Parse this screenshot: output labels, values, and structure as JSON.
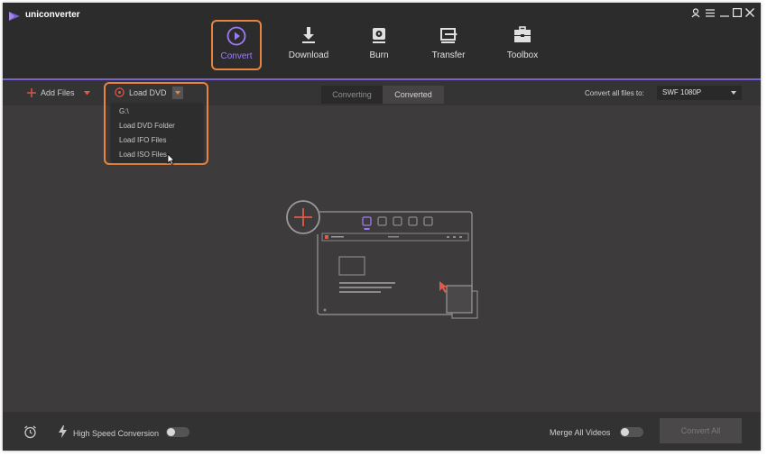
{
  "app": {
    "title": "uniconverter"
  },
  "window_controls": {
    "user_icon": "user-icon",
    "menu_icon": "menu-icon",
    "minimize_icon": "minimize-icon",
    "maximize_icon": "maximize-icon",
    "close_icon": "close-icon"
  },
  "nav": {
    "items": [
      {
        "label": "Convert",
        "icon": "play-circle-icon",
        "active": true
      },
      {
        "label": "Download",
        "icon": "download-icon",
        "active": false
      },
      {
        "label": "Burn",
        "icon": "disc-icon",
        "active": false
      },
      {
        "label": "Transfer",
        "icon": "transfer-icon",
        "active": false
      },
      {
        "label": "Toolbox",
        "icon": "toolbox-icon",
        "active": false
      }
    ]
  },
  "toolbar": {
    "add_files_label": "Add Files",
    "load_dvd_label": "Load DVD",
    "tabs": [
      "Converting",
      "Converted"
    ],
    "active_tab": "Converted",
    "convert_all_label": "Convert all files to:",
    "format_value": "SWF 1080P"
  },
  "dvd_menu": {
    "items": [
      "G:\\",
      "Load DVD Folder",
      "Load IFO Files",
      "Load ISO Files"
    ]
  },
  "bottom": {
    "high_speed_label": "High Speed Conversion",
    "high_speed_on": false,
    "merge_label": "Merge All Videos",
    "merge_on": false,
    "convert_all_button": "Convert All"
  },
  "colors": {
    "accent_purple": "#7a5fd0",
    "highlight_orange": "#e8843f",
    "add_red": "#e05a4a",
    "background": "#3d3b3b"
  }
}
